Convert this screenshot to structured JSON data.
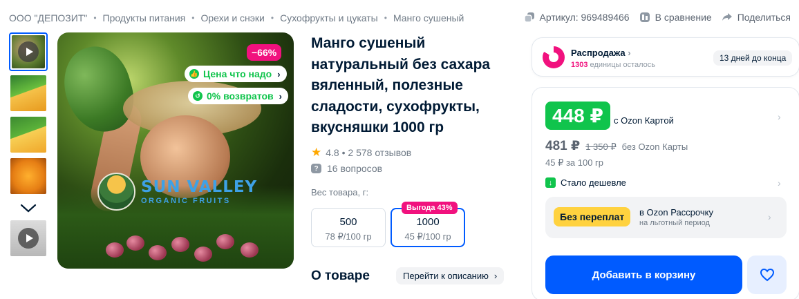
{
  "breadcrumbs": [
    "ООО \"ДЕПОЗИТ\"",
    "Продукты питания",
    "Орехи и снэки",
    "Сухофрукты и цукаты",
    "Манго сушеный"
  ],
  "meta": {
    "article": "Артикул: 969489466",
    "compare": "В сравнение",
    "share": "Поделиться"
  },
  "hero": {
    "discount": "−66%",
    "pill_good_price": "Цена что надо",
    "pill_returns": "0% возвратов",
    "brand_name": "SUN VALLEY",
    "brand_sub": "ORGANIC FRUITS"
  },
  "product": {
    "title": "Манго сушеный натуральный без сахара вяленный, полезные сладости, сухофрукты, вкусняшки 1000 гр",
    "rating": "4.8 • 2 578 отзывов",
    "questions": "16 вопросов",
    "weight_label": "Вес товара, г:",
    "options": [
      {
        "value": "500",
        "price": "78 ₽/100 гр"
      },
      {
        "value": "1000",
        "price": "45 ₽/100 гр",
        "gain": "Выгода 43%",
        "selected": true
      }
    ],
    "about": "О товаре",
    "to_description": "Перейти к описанию"
  },
  "sale": {
    "title": "Распродажа",
    "count": "1303",
    "remaining": "единицы осталось",
    "days": "13 дней до конца"
  },
  "price": {
    "card_price": "448 ₽",
    "card_note": "с Ozon Картой",
    "regular_price": "481 ₽",
    "old_price": "1 350 ₽",
    "regular_note": "без Ozon Карты",
    "per_unit": "45 ₽ за 100 гр",
    "cheaper": "Стало дешевле",
    "installment_badge": "Без переплат",
    "installment_title": "в Ozon Рассрочку",
    "installment_sub": "на льготный период",
    "add_to_cart": "Добавить в корзину"
  },
  "colors": {
    "accent": "#005bff",
    "green": "#10c44c",
    "pink": "#f1117e",
    "yellow": "#ffd23f"
  }
}
